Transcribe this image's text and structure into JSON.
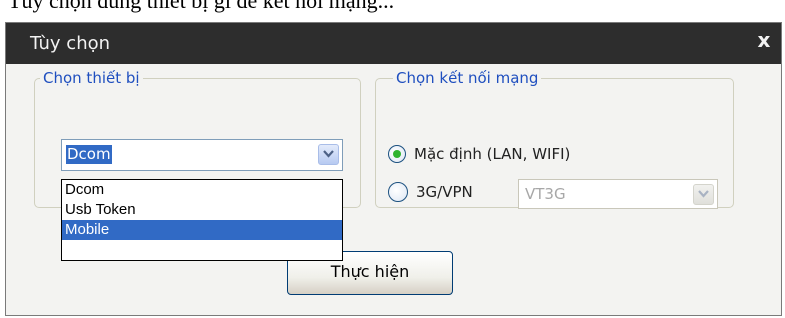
{
  "top_text": "Tùy chọn dùng thiết bị gì để kết nối mạng...",
  "dialog": {
    "title": "Tùy chọn",
    "close_label": "x"
  },
  "device_group": {
    "label": "Chọn thiết bị",
    "selected": "Dcom",
    "options": [
      "Dcom",
      "Usb Token",
      "Mobile"
    ],
    "highlighted_option": "Mobile"
  },
  "network_group": {
    "label": "Chọn kết nối mạng",
    "options": [
      {
        "label": "Mặc định (LAN, WIFI)",
        "checked": true
      },
      {
        "label": "3G/VPN",
        "checked": false
      }
    ],
    "vpn_select_value": "VT3G"
  },
  "run_button": "Thực hiện",
  "colors": {
    "titlebar": "#2d2d2d",
    "group_label": "#1f4fbf",
    "selection": "#316ac5",
    "radio_dot": "#2fb32f"
  }
}
